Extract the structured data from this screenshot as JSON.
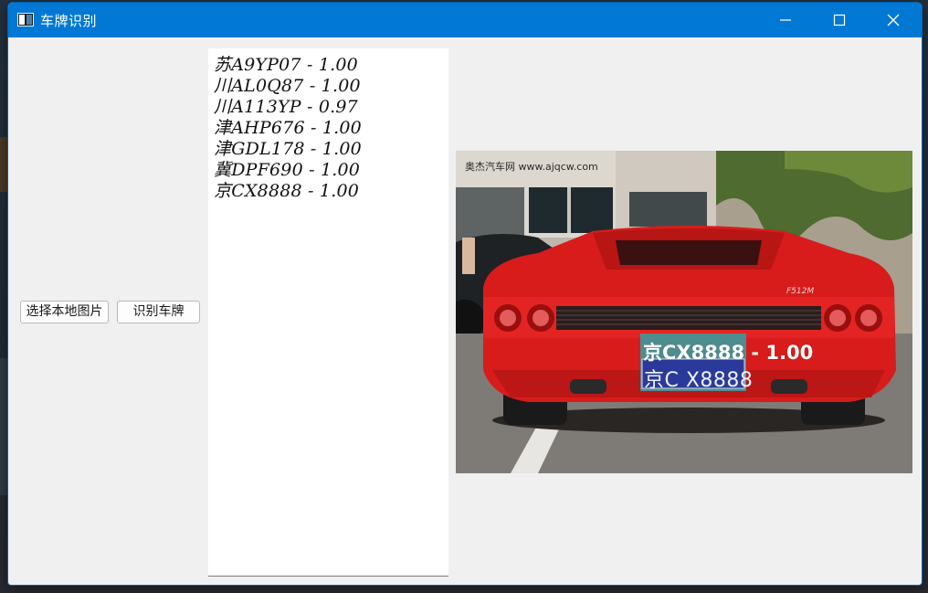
{
  "window": {
    "title": "车牌识别",
    "controls": {
      "minimize": "minimize",
      "maximize": "maximize",
      "close": "close"
    }
  },
  "buttons": {
    "open_image": "选择本地图片",
    "recognize": "识别车牌"
  },
  "results": [
    "苏A9YP07 - 1.00",
    "川AL0Q87 - 1.00",
    "川A113YP - 0.97",
    "津AHP676 - 1.00",
    "津GDL178 - 1.00",
    "冀DPF690 - 1.00",
    "京CX8888 - 1.00"
  ],
  "image": {
    "watermark": "奥杰汽车网 www.ajqcw.com",
    "detection_label": "京CX8888 - 1.00",
    "plate_text": "京C X8888",
    "car_badge": "F512M"
  },
  "colors": {
    "titlebar": "#0078d4",
    "car": "#e01f1f",
    "plate_box": "#4d8d8f",
    "plate": "#2b3a9a"
  }
}
